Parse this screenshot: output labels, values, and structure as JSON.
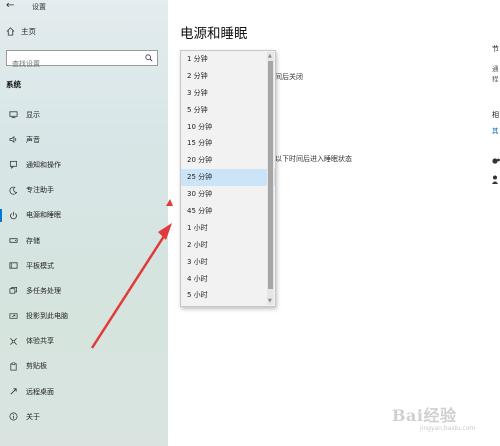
{
  "window": {
    "back_glyph": "←",
    "app_title": "设置"
  },
  "sidebar": {
    "home_label": "主页",
    "search_placeholder": "查找设置",
    "section_label": "系统",
    "items": [
      {
        "label": "显示",
        "icon": "display-icon"
      },
      {
        "label": "声音",
        "icon": "sound-icon"
      },
      {
        "label": "通知和操作",
        "icon": "notification-icon"
      },
      {
        "label": "专注助手",
        "icon": "focus-assist-icon"
      },
      {
        "label": "电源和睡眠",
        "icon": "power-icon",
        "selected": true
      },
      {
        "label": "存储",
        "icon": "storage-icon"
      },
      {
        "label": "平板模式",
        "icon": "tablet-mode-icon"
      },
      {
        "label": "多任务处理",
        "icon": "multitasking-icon"
      },
      {
        "label": "投影到此电脑",
        "icon": "projecting-icon"
      },
      {
        "label": "体验共享",
        "icon": "shared-experiences-icon"
      },
      {
        "label": "剪贴板",
        "icon": "clipboard-icon"
      },
      {
        "label": "远程桌面",
        "icon": "remote-desktop-icon"
      },
      {
        "label": "关于",
        "icon": "about-icon"
      }
    ]
  },
  "main": {
    "title": "电源和睡眠",
    "frag_screen": "下时间后关闭",
    "frag_sleep": "经过以下时间后进入睡眠状态",
    "right": {
      "r1": "节",
      "r2a": "通",
      "r2b": "程",
      "r3": "相",
      "r4": "其"
    }
  },
  "dropdown": {
    "selected": "25 分钟",
    "options": [
      "1 分钟",
      "2 分钟",
      "3 分钟",
      "5 分钟",
      "10 分钟",
      "15 分钟",
      "20 分钟",
      "25 分钟",
      "30 分钟",
      "45 分钟",
      "1 小时",
      "2 小时",
      "3 小时",
      "4 小时",
      "5 小时"
    ]
  },
  "watermark": {
    "text": "Bai经验",
    "sub": "jingyan.baidu.com"
  },
  "colors": {
    "accent": "#0078d4",
    "highlight": "#cce4f7",
    "arrow": "#e03a3a"
  }
}
